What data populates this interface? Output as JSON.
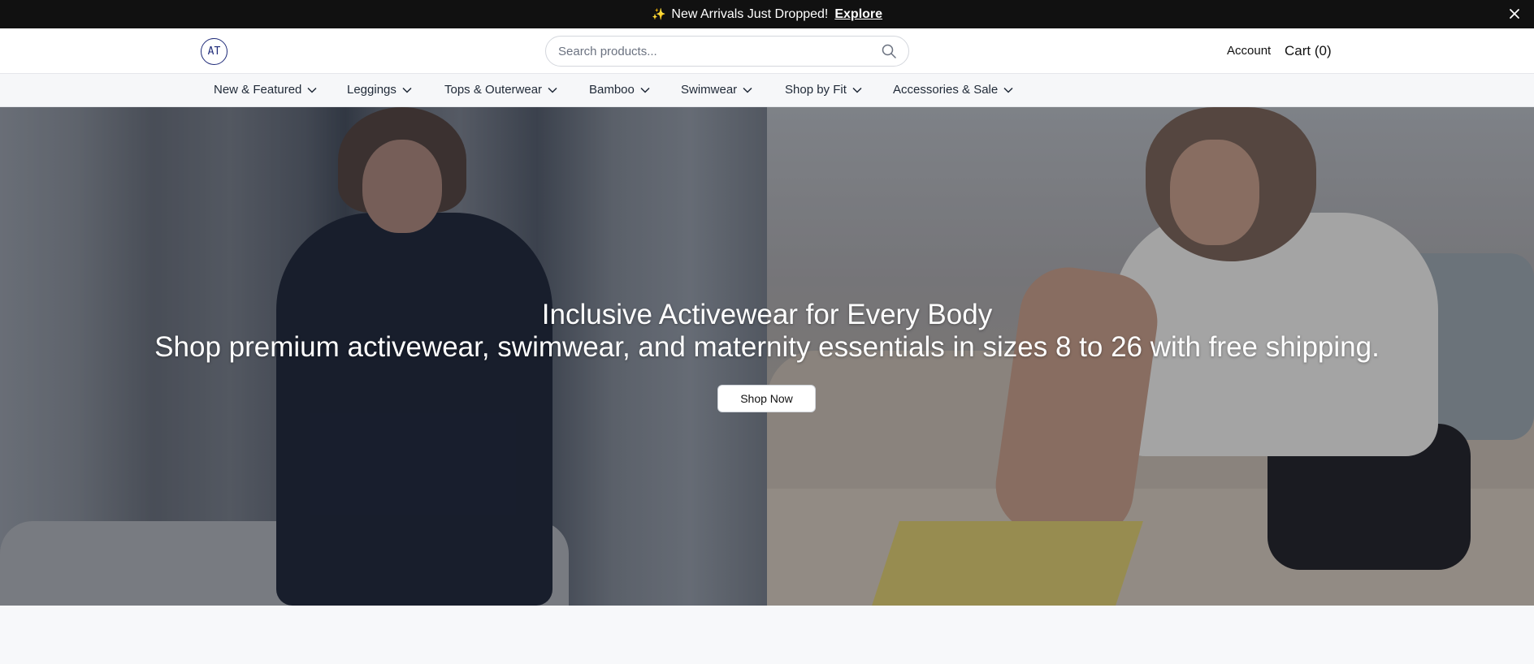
{
  "announcement": {
    "icon": "sparkle-icon",
    "text": "New Arrivals Just Dropped!",
    "link": "Explore"
  },
  "header": {
    "logo": "AT",
    "search_placeholder": "Search products...",
    "account": "Account",
    "cart": "Cart (0)"
  },
  "nav": {
    "items": [
      {
        "label": "New & Featured"
      },
      {
        "label": "Leggings"
      },
      {
        "label": "Tops & Outerwear"
      },
      {
        "label": "Bamboo"
      },
      {
        "label": "Swimwear"
      },
      {
        "label": "Shop by Fit"
      },
      {
        "label": "Accessories & Sale"
      }
    ]
  },
  "hero": {
    "title": "Inclusive Activewear for Every Body",
    "subtitle": "Shop premium activewear, swimwear, and maternity essentials in sizes 8 to 26 with free shipping.",
    "cta": "Shop Now"
  },
  "colors": {
    "announcement_bg": "#111111",
    "logo": "#1e2a78",
    "nav_bg": "#f6f7f9"
  }
}
